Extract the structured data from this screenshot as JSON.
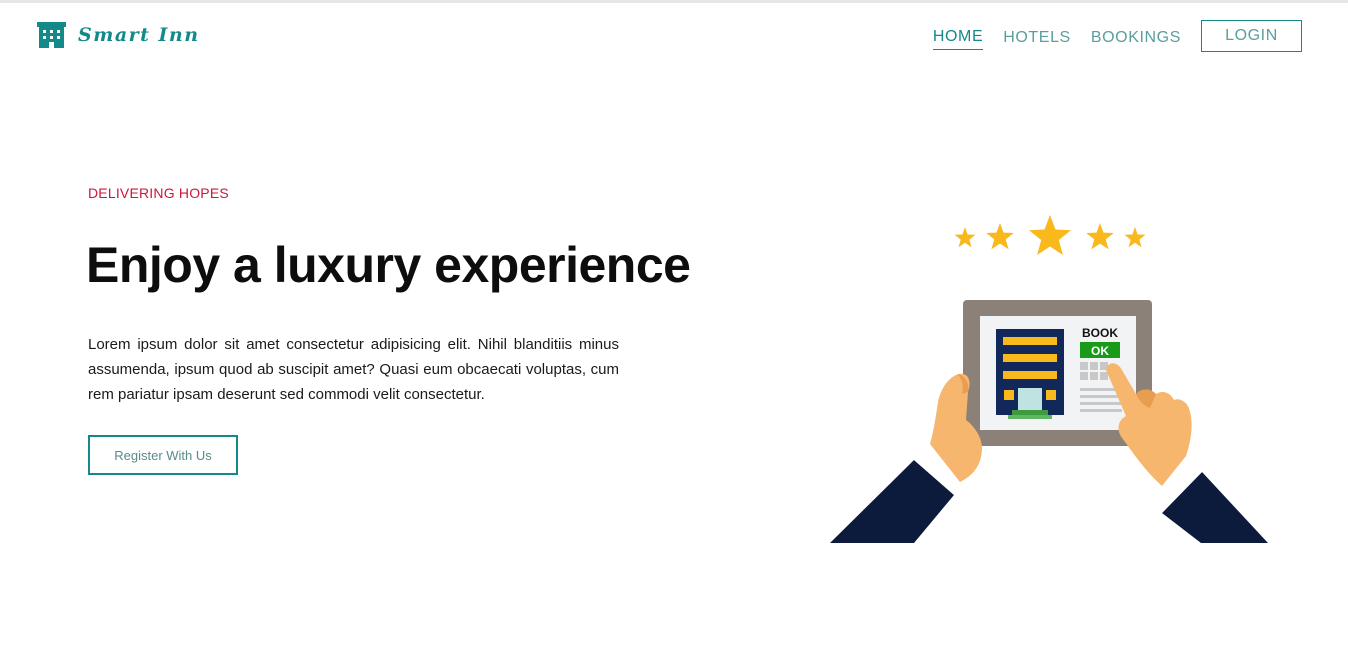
{
  "brand": {
    "name": "Smart Inn",
    "icon": "hotel-building-icon",
    "color": "#14898a"
  },
  "nav": {
    "items": [
      {
        "label": "HOME",
        "active": true
      },
      {
        "label": "HOTELS",
        "active": false
      },
      {
        "label": "BOOKINGS",
        "active": false
      }
    ],
    "login_label": "LOGIN"
  },
  "hero": {
    "eyebrow": "DELIVERING HOPES",
    "title": "Enjoy a luxury experience",
    "text": "Lorem ipsum dolor sit amet consectetur adipisicing elit. Nihil blanditiis minus assumenda, ipsum quod ab suscipit amet? Quasi eum obcaecati voluptas, cum rem pariatur ipsam deserunt sed commodi velit consectetur.",
    "cta_label": "Register With Us"
  },
  "illustration": {
    "book_label": "BOOK",
    "ok_label": "OK",
    "star_count": 5,
    "colors": {
      "star": "#f9b81c",
      "ok": "#1a9a1a",
      "sleeve": "#0c1a3c",
      "skin": "#f6b66e",
      "tablet": "#8b8178"
    }
  },
  "colors": {
    "accent": "#14898a",
    "eyebrow": "#d0143c"
  }
}
